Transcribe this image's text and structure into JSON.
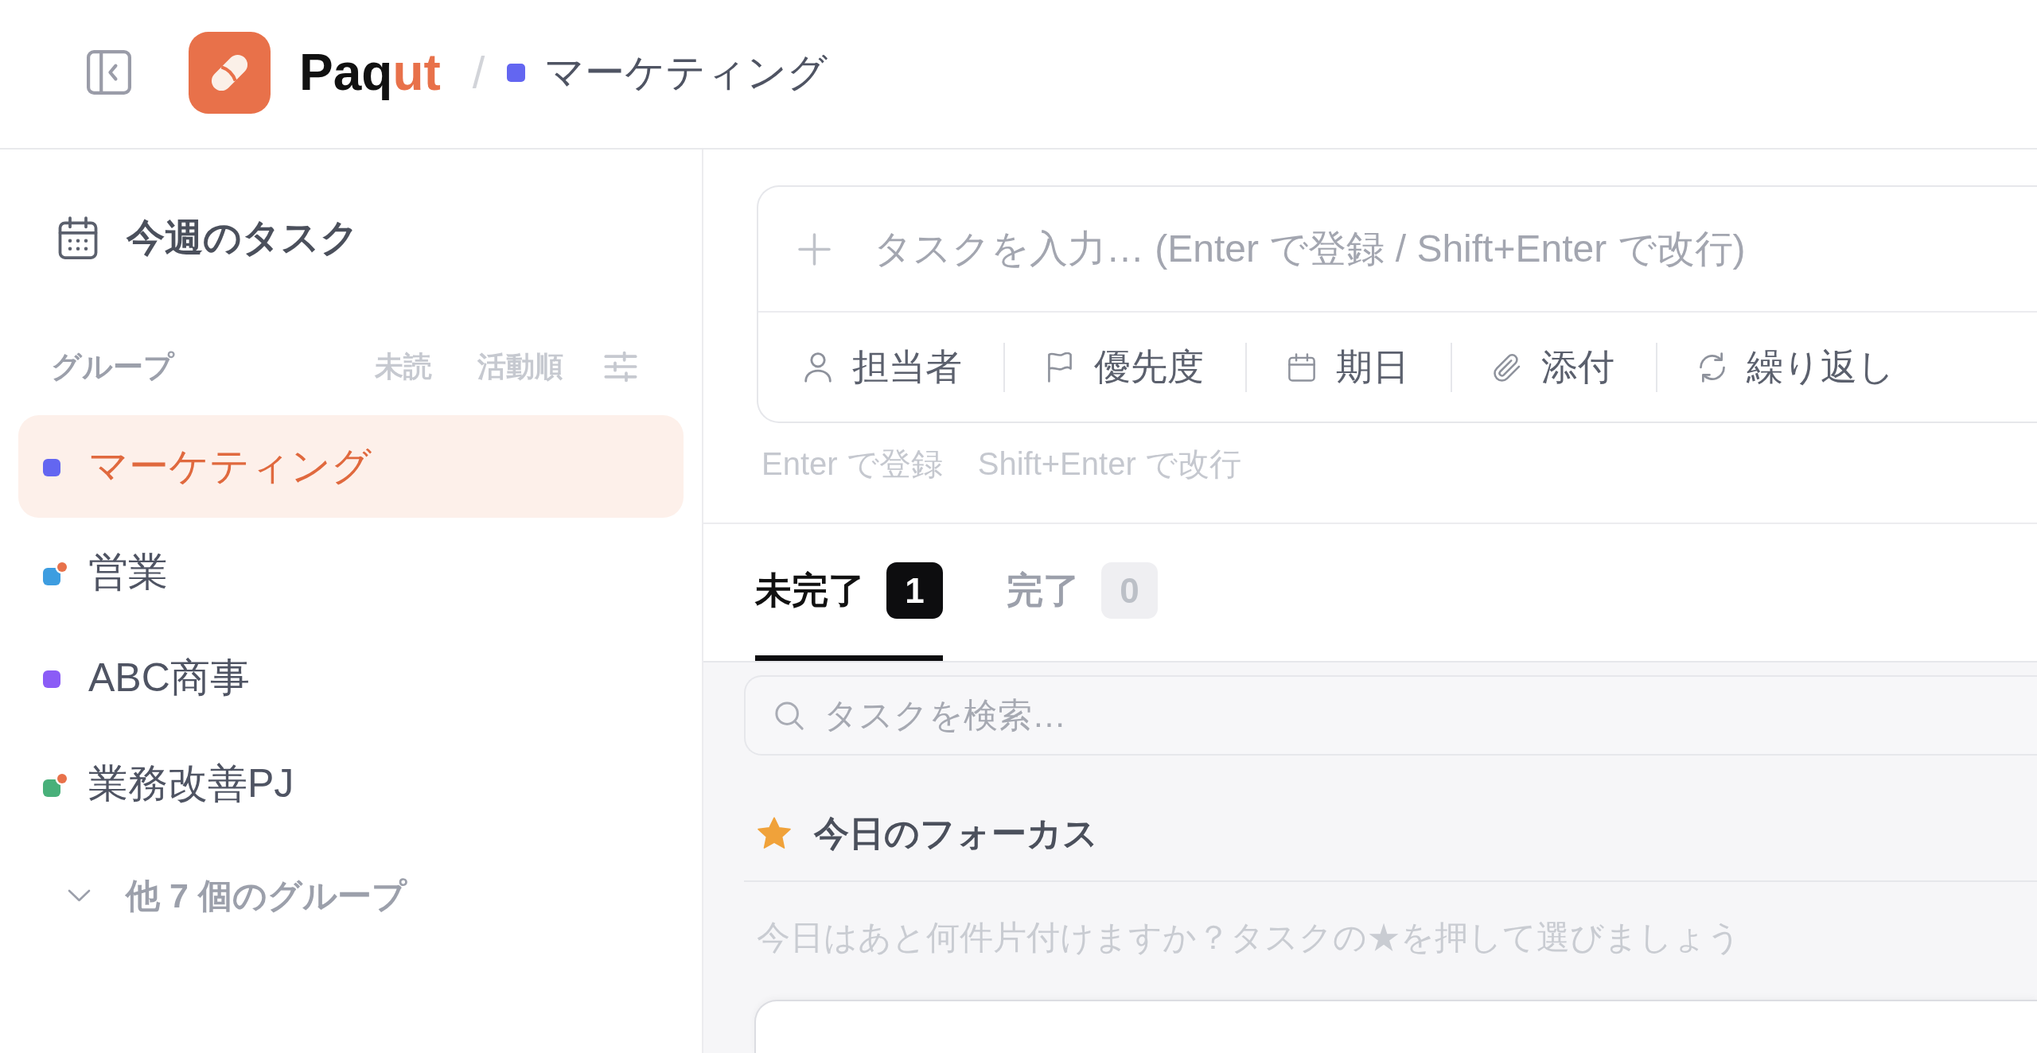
{
  "header": {
    "brand": [
      {
        "text": "Paq",
        "accent": false
      },
      {
        "text": "ut",
        "accent": true
      }
    ],
    "breadcrumb": {
      "separator": "/",
      "label": "マーケティング",
      "color": "#6366f1"
    }
  },
  "sidebar": {
    "nav": {
      "label": "今週のタスク"
    },
    "groups_header": {
      "title": "グループ",
      "unread_filter": "未読",
      "sort": "活動順"
    },
    "groups": [
      {
        "label": "マーケティング",
        "color": "#6366f1",
        "selected": true,
        "unread": false
      },
      {
        "label": "営業",
        "color": "#3d9de0",
        "selected": false,
        "unread": true
      },
      {
        "label": "ABC商事",
        "color": "#8b5cf6",
        "selected": false,
        "unread": false
      },
      {
        "label": "業務改善PJ",
        "color": "#48b07a",
        "selected": false,
        "unread": true
      }
    ],
    "more": {
      "label": "他 7 個のグループ",
      "expanded": false
    }
  },
  "composer": {
    "placeholder": "タスクを入力… (Enter で登録 / Shift+Enter で改行)",
    "options": [
      {
        "kind": "assignee",
        "label": "担当者"
      },
      {
        "kind": "priority",
        "label": "優先度"
      },
      {
        "kind": "due",
        "label": "期日"
      },
      {
        "kind": "attachment",
        "label": "添付"
      },
      {
        "kind": "repeat",
        "label": "繰り返し"
      }
    ],
    "hints": [
      "Enter で登録",
      "Shift+Enter で改行"
    ]
  },
  "tabs": [
    {
      "label": "未完了",
      "count": "1",
      "selected": true
    },
    {
      "label": "完了",
      "count": "0",
      "selected": false
    }
  ],
  "search": {
    "placeholder": "タスクを検索…"
  },
  "focus": {
    "title": "今日のフォーカス",
    "hint": "今日はあと何件片付けますか？タスクの★を押して選びましょう"
  }
}
